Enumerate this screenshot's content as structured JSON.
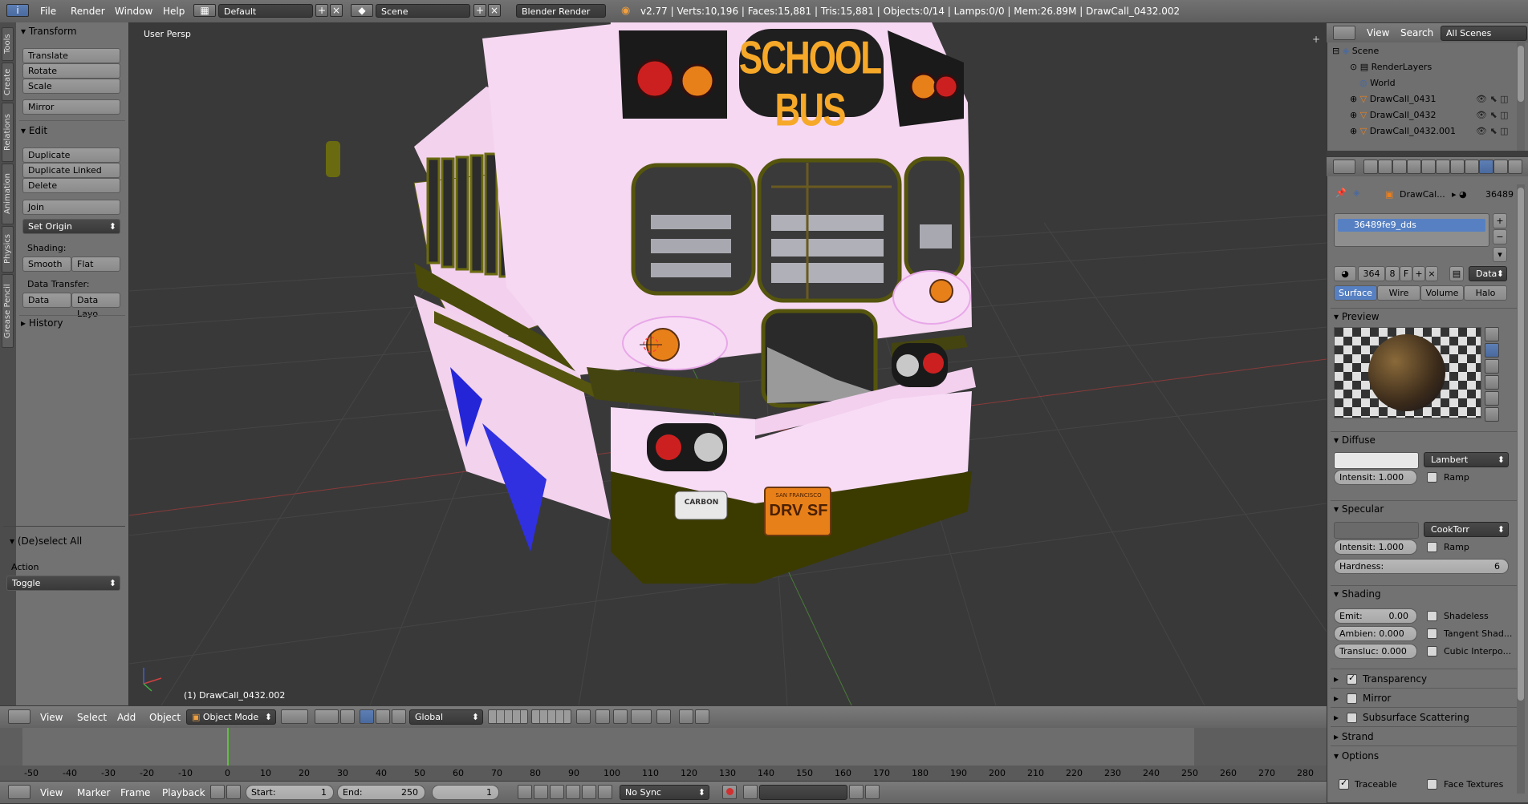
{
  "top_bar": {
    "menus": [
      "File",
      "Render",
      "Window",
      "Help"
    ],
    "layout": "Default",
    "scene": "Scene",
    "engine": "Blender Render",
    "stats": "v2.77 | Verts:10,196 | Faces:15,881 | Tris:15,881 | Objects:0/14 | Lamps:0/0 | Mem:26.89M | DrawCall_0432.002"
  },
  "left_tabs": [
    "Tools",
    "Create",
    "Relations",
    "Animation",
    "Physics",
    "Grease Pencil"
  ],
  "tool_shelf": {
    "transform_header": "Transform",
    "transform_buttons": [
      "Translate",
      "Rotate",
      "Scale"
    ],
    "mirror": "Mirror",
    "edit_header": "Edit",
    "edit_buttons": [
      "Duplicate",
      "Duplicate Linked",
      "Delete"
    ],
    "join": "Join",
    "set_origin": "Set Origin",
    "shading_label": "Shading:",
    "smooth": "Smooth",
    "flat": "Flat",
    "data_transfer_label": "Data Transfer:",
    "data": "Data",
    "data_layo": "Data Layo",
    "history": "History",
    "deselect_header": "(De)select All",
    "action_label": "Action",
    "action_value": "Toggle"
  },
  "viewport": {
    "view_label": "User Persp",
    "object_label": "(1) DrawCall_0432.002",
    "bus_sign": "SCHOOL BUS",
    "plate": "DRV SF",
    "plate_top": "SAN FRANCISCO",
    "badge": "CARBON"
  },
  "viewport_header": {
    "menus": [
      "View",
      "Select",
      "Add",
      "Object"
    ],
    "mode": "Object Mode",
    "orientation": "Global"
  },
  "timeline": {
    "ticks": [
      "-50",
      "-40",
      "-30",
      "-20",
      "-10",
      "0",
      "10",
      "20",
      "30",
      "40",
      "50",
      "60",
      "70",
      "80",
      "90",
      "100",
      "110",
      "120",
      "130",
      "140",
      "150",
      "160",
      "170",
      "180",
      "190",
      "200",
      "210",
      "220",
      "230",
      "240",
      "250",
      "260",
      "270",
      "280"
    ],
    "menus": [
      "View",
      "Marker",
      "Frame",
      "Playback"
    ],
    "start": "Start:",
    "start_value": "1",
    "end": "End:",
    "end_value": "250",
    "current": "1",
    "sync": "No Sync"
  },
  "outliner": {
    "menus": [
      "View",
      "Search"
    ],
    "filter": "All Scenes",
    "rows": [
      "Scene",
      "RenderLayers",
      "World",
      "DrawCall_0431",
      "DrawCall_0432",
      "DrawCall_0432.001"
    ]
  },
  "properties": {
    "breadcrumb": "DrawCal...",
    "material_id": "36489",
    "material_slot": "36489fe9_dds",
    "users": "364",
    "fake": "8",
    "f_label": "F",
    "data_dropdown": "Data",
    "tabs": [
      "Surface",
      "Wire",
      "Volume",
      "Halo"
    ],
    "preview_label": "Preview",
    "diffuse_label": "Diffuse",
    "diffuse_shader": "Lambert",
    "diffuse_intensity": "Intensit: 1.000",
    "ramp": "Ramp",
    "specular_label": "Specular",
    "specular_shader": "CookTorr",
    "specular_intensity": "Intensit: 1.000",
    "hardness_label": "Hardness:",
    "hardness_value": "6",
    "shading_label": "Shading",
    "emit": "Emit:",
    "emit_value": "0.00",
    "ambient": "Ambien: 0.000",
    "transluc": "Transluc: 0.000",
    "shadeless": "Shadeless",
    "tangent": "Tangent Shad...",
    "cubic": "Cubic Interpo...",
    "transparency": "Transparency",
    "mirror": "Mirror",
    "sss": "Subsurface Scattering",
    "strand": "Strand",
    "options": "Options",
    "traceable": "Traceable",
    "face_textures": "Face Textures"
  },
  "colors": {
    "accent_blue": "#5680c2",
    "bus_pink": "#f6d8f2"
  }
}
